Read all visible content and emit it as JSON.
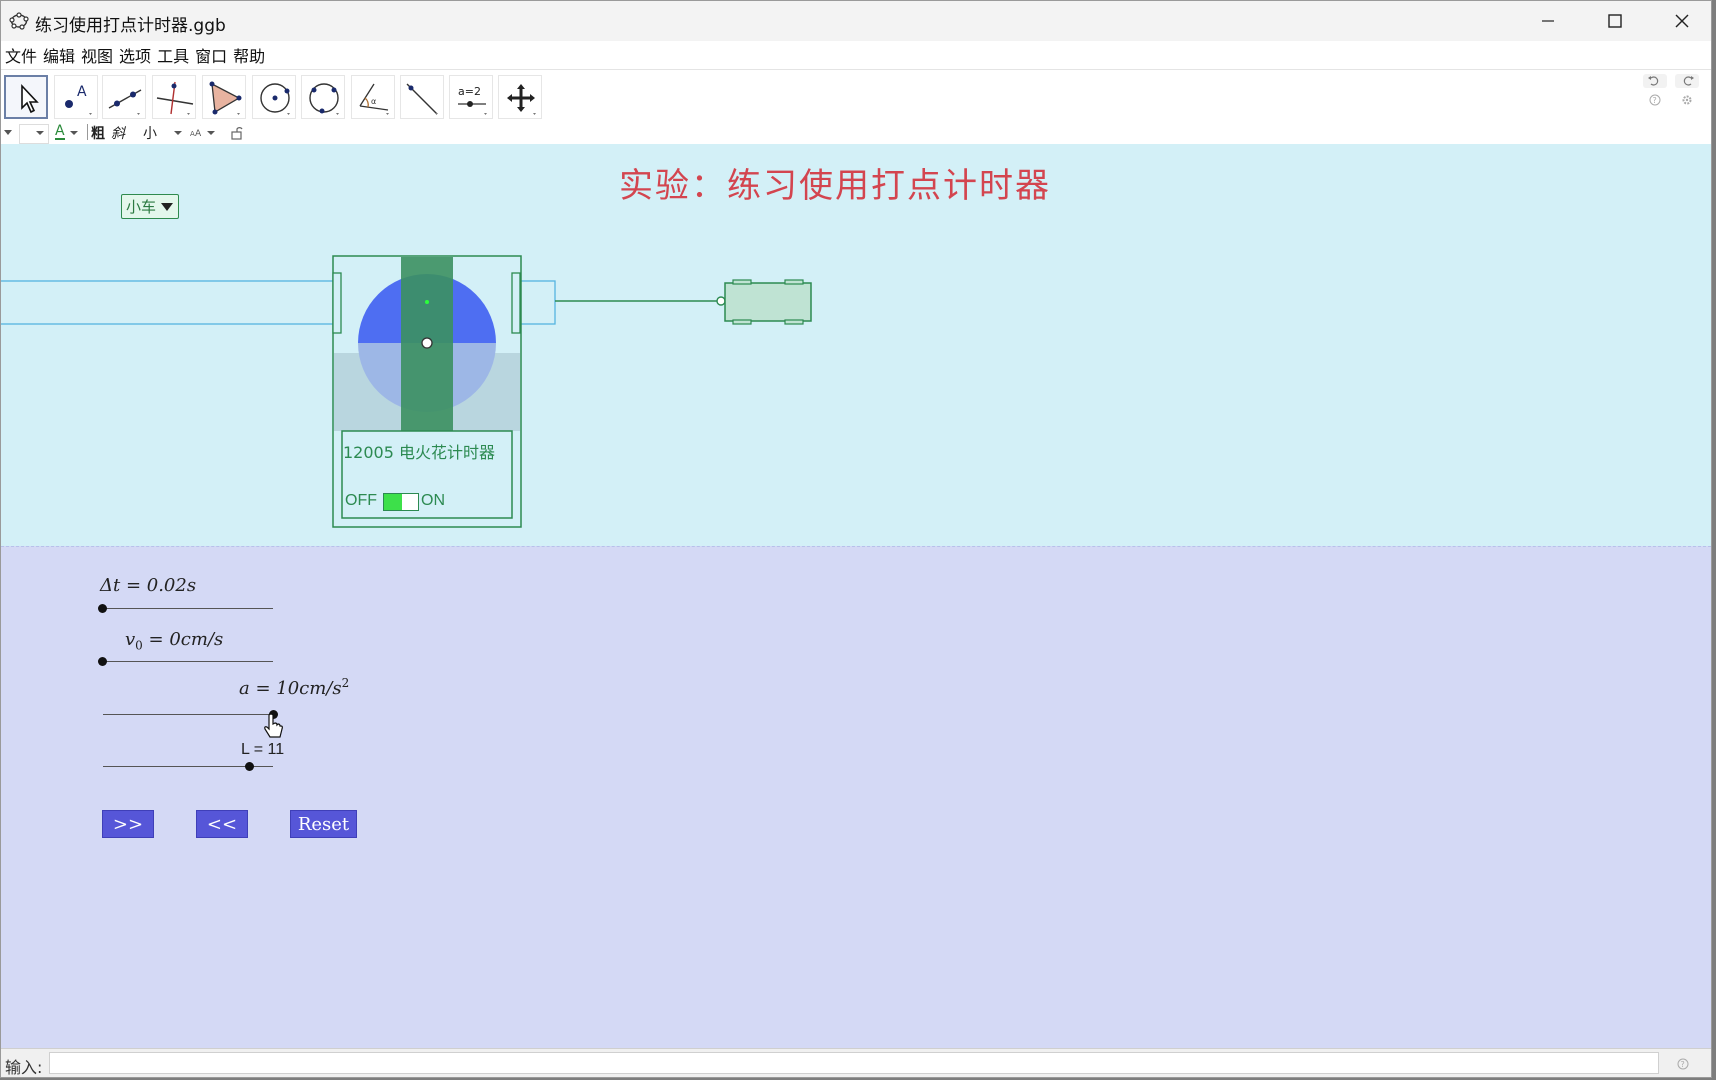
{
  "window": {
    "title": "练习使用打点计时器.ggb"
  },
  "menu": [
    "文件",
    "编辑",
    "视图",
    "选项",
    "工具",
    "窗口",
    "帮助"
  ],
  "toolbar": {
    "tools": [
      "move-tool",
      "point-tool",
      "line-tool",
      "perpendicular-line-tool",
      "polygon-tool",
      "circle-tool",
      "conic-tool",
      "angle-tool",
      "reflect-tool",
      "slider-tool",
      "move-view-tool"
    ],
    "slider_tool_label": "a=2"
  },
  "stylebar": {
    "text_color_label": "A",
    "bold_label": "粗",
    "italic_label": "斜",
    "size_label": "小"
  },
  "graphics": {
    "title": "实验：练习使用打点计时器",
    "dropdown_value": "小车",
    "timer_label": "12005  电火花计时器",
    "switch_off": "OFF",
    "switch_on": "ON",
    "colors": {
      "title": "#d3454f",
      "timer": "#2c8a51",
      "disc_blue": "#4e6ef2",
      "tape_green": "#3c9060"
    }
  },
  "sliders": {
    "dt_label": "Δt = 0.02s",
    "v0_label_main": "v",
    "v0_label_sub": "0",
    "v0_label_rest": " = 0cm/s",
    "a_label_main": "a = 10cm/s",
    "a_label_sup": "2",
    "L_label": "L = 11"
  },
  "buttons": {
    "forward": ">>",
    "back": "<<",
    "reset": "Reset"
  },
  "input": {
    "label": "输入:",
    "value": ""
  }
}
